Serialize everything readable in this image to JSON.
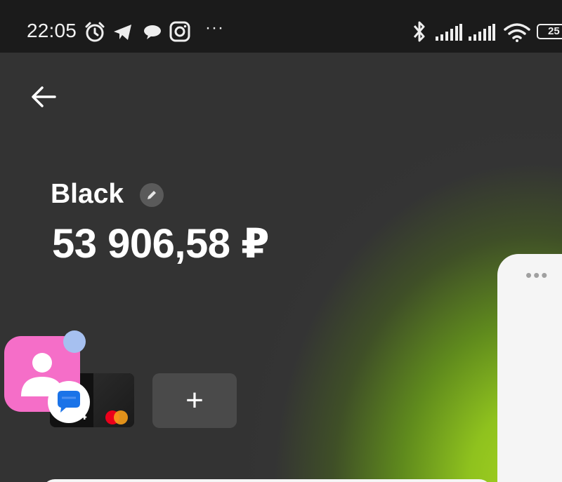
{
  "status_bar": {
    "time": "22:05",
    "battery": "25",
    "icons": [
      "alarm-icon",
      "telegram-icon",
      "chat-bubble-icon",
      "instagram-icon",
      "more-dots-icon",
      "bluetooth-icon",
      "signal-icon",
      "signal-icon",
      "wifi-icon",
      "battery-icon"
    ],
    "more": "···"
  },
  "header": {
    "back_icon": "arrow-left-icon"
  },
  "account": {
    "name": "Black",
    "edit_icon": "pencil-icon",
    "balance": "53 906,58 ₽"
  },
  "cards": {
    "card_digits": "6614",
    "card_brand_icon": "mastercard-icon",
    "add_label": "+"
  },
  "side_panel": {
    "more_label": "•••"
  },
  "overlay": {
    "contacts_app_icon": "contacts-app-icon",
    "messages_badge_icon": "messages-icon"
  },
  "colors": {
    "background": "#333333",
    "accent_glow": "#a6d321",
    "fab": "#f56ec8",
    "badge_dot": "#a6c0f0"
  }
}
